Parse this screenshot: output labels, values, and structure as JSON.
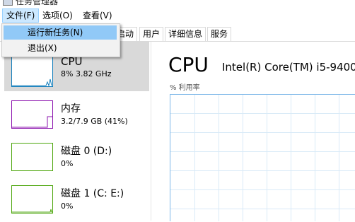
{
  "window": {
    "title": "任务管理器"
  },
  "menubar": {
    "file": "文件(F)",
    "options": "选项(O)",
    "view": "查看(V)"
  },
  "file_menu": {
    "items": [
      "运行新任务(N)",
      "退出(X)"
    ]
  },
  "tabs": [
    "启动",
    "用户",
    "详细信息",
    "服务"
  ],
  "resources": [
    {
      "name": "CPU",
      "value": "8% 3.82 GHz",
      "color": "#117dbb"
    },
    {
      "name": "内存",
      "value": "3.2/7.9 GB (41%)",
      "color": "#8b12ae"
    },
    {
      "name": "磁盘 0 (D:)",
      "value": "0%",
      "color": "#4da60c"
    },
    {
      "name": "磁盘 1 (C: E:)",
      "value": "0%",
      "color": "#4da60c"
    }
  ],
  "detail": {
    "title": "CPU",
    "model": "Intel(R) Core(TM) i5-9400",
    "util_label": "% 利用率"
  },
  "colors": {
    "cpu": "#117dbb",
    "memory": "#8b12ae",
    "disk": "#4da60c",
    "menu_hover": "#91c9f7",
    "selected": "#d9d9d9"
  }
}
